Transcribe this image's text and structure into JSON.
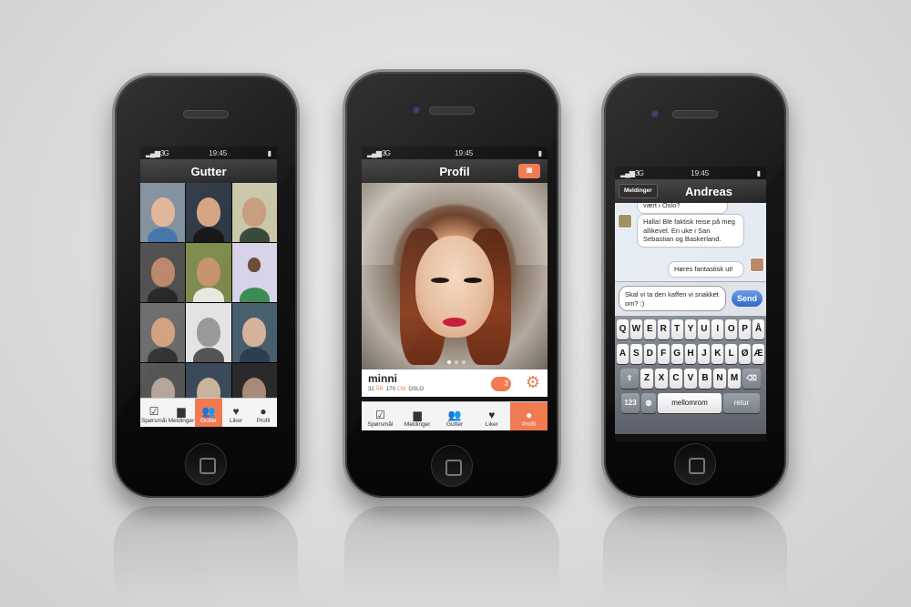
{
  "status": {
    "carrier": "3G",
    "time": "19:45"
  },
  "left": {
    "title": "Gutter",
    "tabs": [
      {
        "label": "Spørsmål",
        "icon": "check-icon"
      },
      {
        "label": "Meldinger",
        "icon": "chat-icon"
      },
      {
        "label": "Gutter",
        "icon": "people-icon",
        "active": true
      },
      {
        "label": "Liker",
        "icon": "heart-icon"
      },
      {
        "label": "Profil",
        "icon": "person-icon"
      }
    ]
  },
  "center": {
    "title": "Profil",
    "profile": {
      "name": "minni",
      "age": "32",
      "age_unit": "ÅR",
      "height": "170",
      "height_unit": "CM",
      "city": "OSLO",
      "coins": "3"
    },
    "tabs": [
      {
        "label": "Spørsmål",
        "icon": "check-icon"
      },
      {
        "label": "Meldinger",
        "icon": "chat-icon"
      },
      {
        "label": "Gutter",
        "icon": "people-icon"
      },
      {
        "label": "Liker",
        "icon": "heart-icon"
      },
      {
        "label": "Profil",
        "icon": "person-icon",
        "active": true
      }
    ]
  },
  "right": {
    "title": "Andreas",
    "back_label": "Meldinger",
    "messages": [
      {
        "text": "vært i Oslo?"
      },
      {
        "text": "Halla! Ble faktisk reise på meg allikevel. En uke i San Sebastian og Baskerland."
      },
      {
        "text": "Høres fantastisk ut!"
      }
    ],
    "draft": "Skal vi ta den kaffen vi snakket om? :)",
    "send_label": "Send",
    "keyboard": {
      "row1": [
        "Q",
        "W",
        "E",
        "R",
        "T",
        "Y",
        "U",
        "I",
        "O",
        "P",
        "Å"
      ],
      "row2": [
        "A",
        "S",
        "D",
        "F",
        "G",
        "H",
        "J",
        "K",
        "L",
        "Ø",
        "Æ"
      ],
      "row3": [
        "Z",
        "X",
        "C",
        "V",
        "B",
        "N",
        "M"
      ],
      "numbers_label": "123",
      "space_label": "mellomrom",
      "return_label": "retur"
    }
  }
}
